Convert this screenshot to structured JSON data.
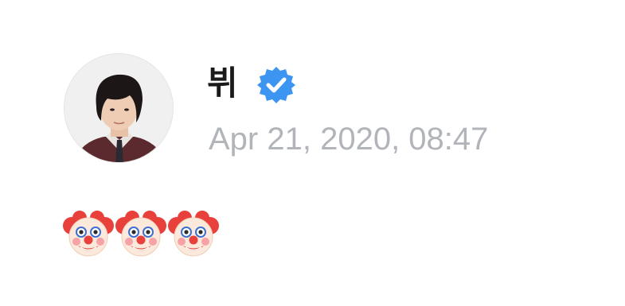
{
  "post": {
    "author_name": "뷔",
    "verified": true,
    "verified_color": "#3d95f2",
    "timestamp": "Apr 21, 2020, 08:47",
    "content_icons": [
      "clown-face-icon",
      "clown-face-icon",
      "clown-face-icon"
    ]
  },
  "colors": {
    "name": "#1a1a1a",
    "timestamp": "#b1b5ba",
    "background": "#ffffff"
  }
}
